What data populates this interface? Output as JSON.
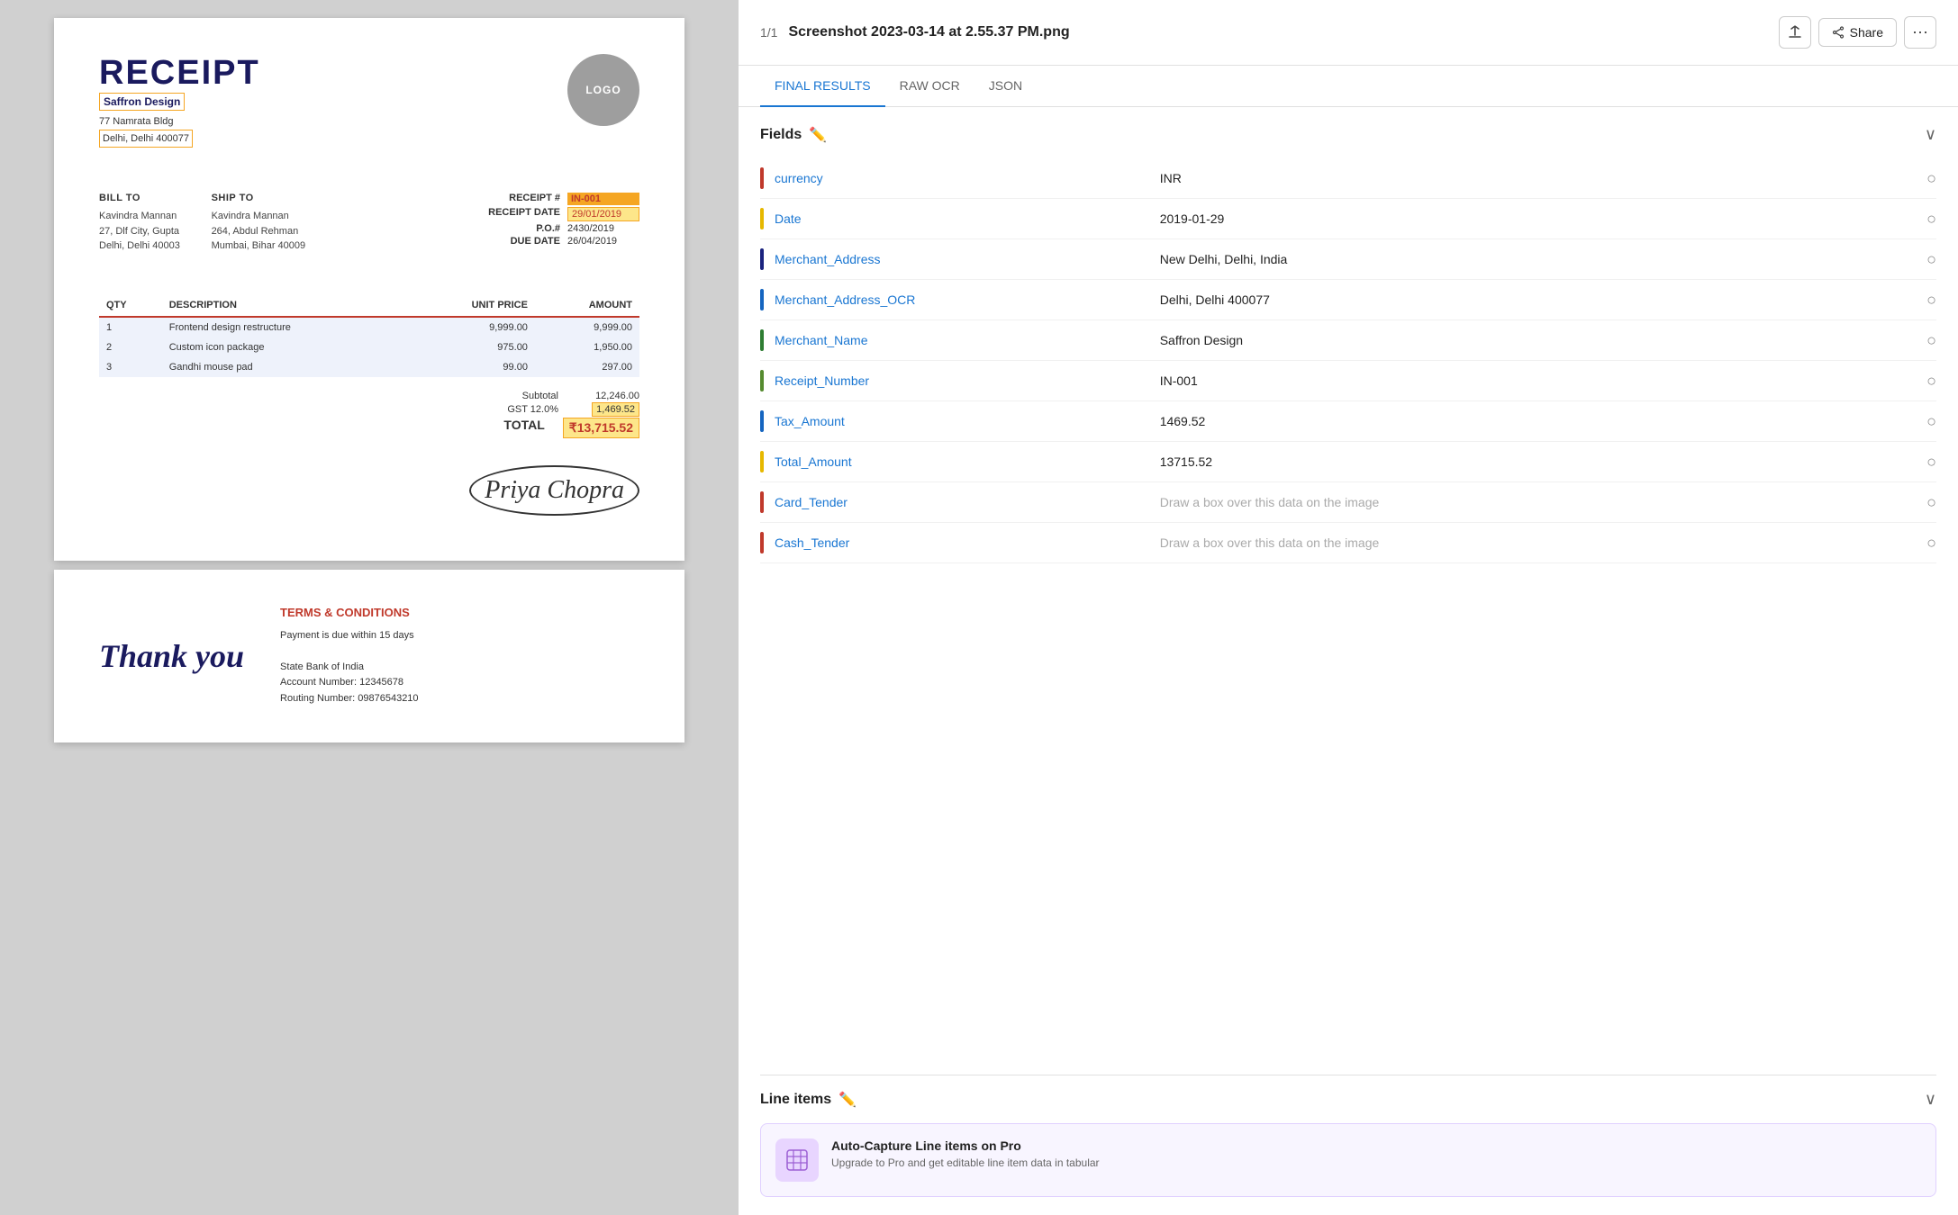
{
  "app": {
    "page_indicator": "1/1",
    "file_name": "Screenshot 2023-03-14 at 2.55.37 PM.png"
  },
  "header_actions": {
    "share_label": "Share",
    "more_label": "⋯"
  },
  "tabs": [
    {
      "id": "final-results",
      "label": "FINAL RESULTS",
      "active": true
    },
    {
      "id": "raw-ocr",
      "label": "RAW OCR",
      "active": false
    },
    {
      "id": "json",
      "label": "JSON",
      "active": false
    }
  ],
  "fields_section": {
    "title": "Fields",
    "fields": [
      {
        "id": "currency",
        "name": "currency",
        "value": "INR",
        "color": "#c0392b",
        "placeholder": false
      },
      {
        "id": "date",
        "name": "Date",
        "value": "2019-01-29",
        "color": "#e6b800",
        "placeholder": false
      },
      {
        "id": "merchant_address",
        "name": "Merchant_Address",
        "value": "New Delhi, Delhi, India",
        "color": "#1a237e",
        "placeholder": false
      },
      {
        "id": "merchant_address_ocr",
        "name": "Merchant_Address_OCR",
        "value": "Delhi, Delhi 400077",
        "color": "#1565c0",
        "placeholder": false
      },
      {
        "id": "merchant_name",
        "name": "Merchant_Name",
        "value": "Saffron Design",
        "color": "#2e7d32",
        "placeholder": false
      },
      {
        "id": "receipt_number",
        "name": "Receipt_Number",
        "value": "IN-001",
        "color": "#558b2f",
        "placeholder": false
      },
      {
        "id": "tax_amount",
        "name": "Tax_Amount",
        "value": "1469.52",
        "color": "#1565c0",
        "placeholder": false
      },
      {
        "id": "total_amount",
        "name": "Total_Amount",
        "value": "13715.52",
        "color": "#e6b800",
        "placeholder": false
      },
      {
        "id": "card_tender",
        "name": "Card_Tender",
        "value": "",
        "color": "#c0392b",
        "placeholder": true,
        "placeholder_text": "Draw a box over this data on the image"
      },
      {
        "id": "cash_tender",
        "name": "Cash_Tender",
        "value": "",
        "color": "#c0392b",
        "placeholder": true,
        "placeholder_text": "Draw a box over this data on the image"
      }
    ]
  },
  "line_items_section": {
    "title": "Line items",
    "pro_card": {
      "title": "Auto-Capture Line items on Pro",
      "description": "Upgrade to Pro and get editable line item data in tabular"
    }
  },
  "receipt": {
    "title": "RECEIPT",
    "logo_text": "LOGO",
    "merchant": {
      "name": "Saffron Design",
      "address_line1": "77 Namrata Bldg",
      "address_line2": "Delhi, Delhi 400077"
    },
    "bill_to": {
      "label": "BILL TO",
      "name": "Kavindra Mannan",
      "address1": "27, Dlf City, Gupta",
      "address2": "Delhi, Delhi 40003"
    },
    "ship_to": {
      "label": "SHIP TO",
      "name": "Kavindra Mannan",
      "address1": "264, Abdul Rehman",
      "address2": "Mumbai, Bihar 40009"
    },
    "receipt_fields": {
      "receipt_num_label": "RECEIPT #",
      "receipt_num_value": "IN-001",
      "receipt_date_label": "RECEIPT DATE",
      "receipt_date_value": "29/01/2019",
      "po_label": "P.O.#",
      "po_value": "2430/2019",
      "due_date_label": "DUE DATE",
      "due_date_value": "26/04/2019"
    },
    "table": {
      "headers": [
        "QTY",
        "DESCRIPTION",
        "UNIT PRICE",
        "AMOUNT"
      ],
      "rows": [
        {
          "qty": "1",
          "description": "Frontend design restructure",
          "unit_price": "9,999.00",
          "amount": "9,999.00"
        },
        {
          "qty": "2",
          "description": "Custom icon package",
          "unit_price": "975.00",
          "amount": "1,950.00"
        },
        {
          "qty": "3",
          "description": "Gandhi mouse pad",
          "unit_price": "99.00",
          "amount": "297.00"
        }
      ]
    },
    "totals": {
      "subtotal_label": "Subtotal",
      "subtotal_value": "12,246.00",
      "tax_label": "GST 12.0%",
      "tax_value": "1,469.52",
      "total_label": "TOTAL",
      "total_value": "₹13,715.52"
    }
  },
  "receipt_page2": {
    "thank_you": "Thank you",
    "terms_title": "TERMS & CONDITIONS",
    "terms_lines": [
      "Payment is due within 15 days",
      "",
      "State Bank of India",
      "Account Number: 12345678",
      "Routing Number: 09876543210"
    ]
  }
}
